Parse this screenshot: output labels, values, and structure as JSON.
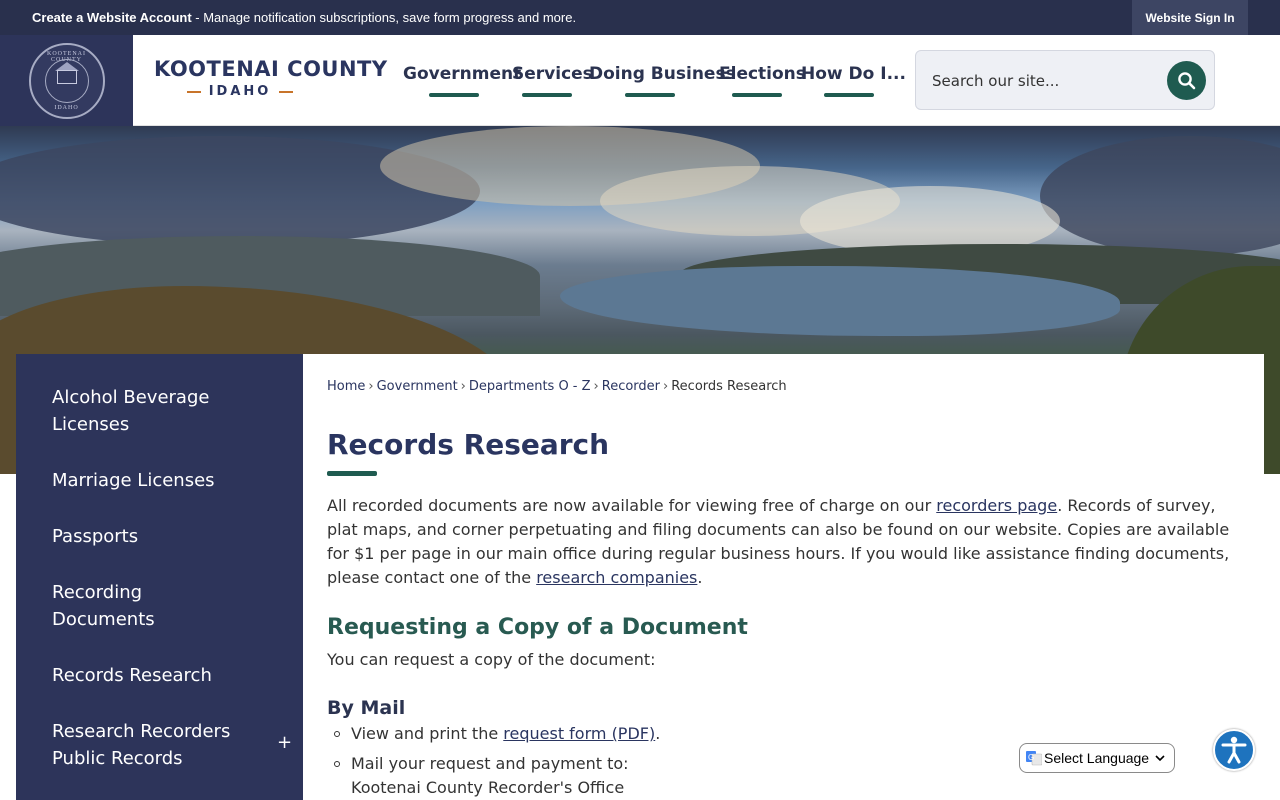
{
  "topbar": {
    "create_account_bold": "Create a Website Account",
    "create_account_rest": " - Manage notification subscriptions, save form progress and more.",
    "sign_in": "Website Sign In"
  },
  "header": {
    "seal_text_top": "KOOTENAI COUNTY",
    "seal_text_bottom": "IDAHO",
    "logo_county": "KOOTENAI COUNTY",
    "logo_state": "IDAHO",
    "nav": [
      "Government",
      "Services",
      "Doing Business",
      "Elections",
      "How Do I..."
    ],
    "search_placeholder": "Search our site..."
  },
  "sidebar": {
    "items": [
      {
        "label": "Alcohol Beverage Licenses"
      },
      {
        "label": "Marriage Licenses"
      },
      {
        "label": "Passports"
      },
      {
        "label": "Recording Documents"
      },
      {
        "label": "Records Research"
      },
      {
        "label": "Research Recorders Public Records",
        "expand": "+"
      }
    ]
  },
  "content": {
    "breadcrumb": [
      "Home",
      "Government",
      "Departments O - Z",
      "Recorder",
      "Records Research"
    ],
    "breadcrumb_sep": "›",
    "title": "Records Research",
    "intro_1": "All recorded documents are now available for viewing free of charge on our ",
    "intro_link_1": "recorders page",
    "intro_2": ". Records of survey, plat maps, and corner perpetuating and filing documents can also be found on our website. Copies are available for $1 per page in our main office during regular business hours. If you would like assistance finding documents, please contact one of the ",
    "intro_link_2": "research companies",
    "intro_3": ".",
    "section_title": "Requesting a Copy of a Document",
    "section_text": "You can request a copy of the document:",
    "mail_title": "By Mail",
    "bullet_1_pre": "View and print the ",
    "bullet_1_link": "request form (PDF)",
    "bullet_1_post": ".",
    "bullet_2": "Mail your request and payment to:",
    "bullet_2_line2": "Kootenai County Recorder's Office"
  },
  "widgets": {
    "language": "Select Language"
  },
  "colors": {
    "navy": "#2d345a",
    "topbar": "#29304d",
    "accent_green": "#1f5b50",
    "logo_dash": "#c8742a"
  }
}
